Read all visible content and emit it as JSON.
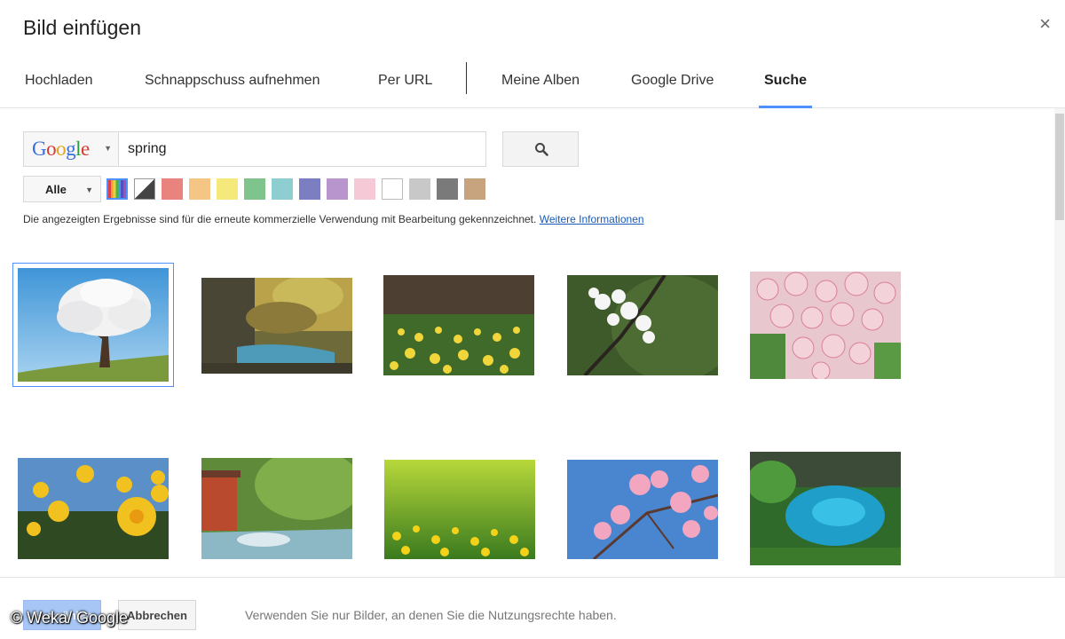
{
  "dialog": {
    "title": "Bild einfügen",
    "close_symbol": "×"
  },
  "tabs": [
    {
      "label": "Hochladen",
      "active": false
    },
    {
      "label": "Schnappschuss aufnehmen",
      "active": false
    },
    {
      "label": "Per URL",
      "active": false
    },
    {
      "label": "Meine Alben",
      "active": false
    },
    {
      "label": "Google Drive",
      "active": false
    },
    {
      "label": "Suche",
      "active": true
    }
  ],
  "search": {
    "engine": "Google",
    "engine_letter_colors": [
      "#3b6fd8",
      "#d83a2f",
      "#e3a41d",
      "#3b6fd8",
      "#2f9a46",
      "#d83a2f"
    ],
    "query": "spring",
    "button_icon": "magnifier-icon"
  },
  "filters": {
    "type_label": "Alle",
    "colors": [
      {
        "name": "all-colors",
        "color": "multicolor",
        "selected": true
      },
      {
        "name": "black-white",
        "color": "bw",
        "selected": false
      },
      {
        "name": "red",
        "color": "#e8837d",
        "selected": false
      },
      {
        "name": "orange",
        "color": "#f4c585",
        "selected": false
      },
      {
        "name": "yellow",
        "color": "#f6e97c",
        "selected": false
      },
      {
        "name": "green",
        "color": "#7fc48c",
        "selected": false
      },
      {
        "name": "teal",
        "color": "#8ecdd0",
        "selected": false
      },
      {
        "name": "blue",
        "color": "#7b7fc2",
        "selected": false
      },
      {
        "name": "purple",
        "color": "#b895cd",
        "selected": false
      },
      {
        "name": "pink",
        "color": "#f6c9d6",
        "selected": false
      },
      {
        "name": "white",
        "color": "#ffffff",
        "selected": false
      },
      {
        "name": "gray",
        "color": "#c8c8c8",
        "selected": false
      },
      {
        "name": "dark-gray",
        "color": "#7a7a7a",
        "selected": false
      },
      {
        "name": "brown",
        "color": "#c8a47e",
        "selected": false
      }
    ]
  },
  "notice": {
    "text": "Die angezeigten Ergebnisse sind für die erneute kommerzielle Verwendung mit Bearbeitung gekennzeichnet.",
    "link": "Weitere Informationen"
  },
  "results": [
    {
      "name": "tree-blossom-image",
      "selected": true
    },
    {
      "name": "forest-stream-image",
      "selected": false
    },
    {
      "name": "daffodil-meadow-image",
      "selected": false
    },
    {
      "name": "white-blossom-branch-image",
      "selected": false
    },
    {
      "name": "pink-blossoms-image",
      "selected": false
    },
    {
      "name": "daffodils-closeup-image",
      "selected": false
    },
    {
      "name": "red-mill-river-image",
      "selected": false
    },
    {
      "name": "yellow-flowers-field-image",
      "selected": false
    },
    {
      "name": "pink-flowers-sky-image",
      "selected": false
    },
    {
      "name": "blue-pool-forest-image",
      "selected": false
    }
  ],
  "footer": {
    "select_label": "Auswählen",
    "cancel_label": "Abbrechen",
    "note": "Verwenden Sie nur Bilder, an denen Sie die Nutzungsrechte haben.",
    "watermark": "© Weka/ Google"
  }
}
